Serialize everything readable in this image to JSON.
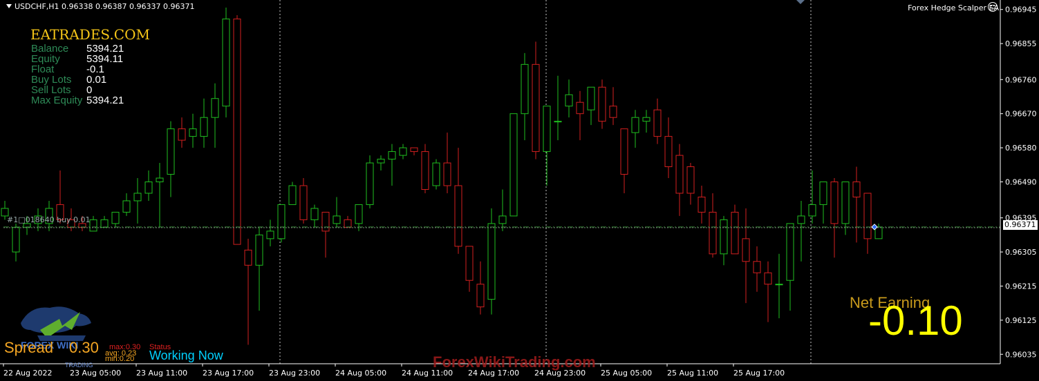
{
  "header": {
    "symbol": "USDCHF,H1  0.96338 0.96387 0.96337 0.96371",
    "ea_name": "Forex Hedge Scalper EA"
  },
  "info_panel": {
    "brand": "EATRADES.COM",
    "rows": [
      {
        "label": "Balance",
        "value": "5394.21"
      },
      {
        "label": "Equity",
        "value": "5394.11"
      },
      {
        "label": "Float",
        "value": "-0.1"
      },
      {
        "label": "Buy Lots",
        "value": "0.01"
      },
      {
        "label": "Sell Lots",
        "value": "0"
      },
      {
        "label": "Max Equity",
        "value": "5394.21"
      }
    ]
  },
  "spread": {
    "label": "Spread",
    "value": "0.30",
    "max": "max:0.30",
    "avg": "avg: 0.23",
    "min": "min:0.20",
    "status_label": "Status",
    "status_value": "Working Now"
  },
  "net_earning": {
    "label": "Net Earning",
    "value": "-0.10"
  },
  "watermark": "ForexWikiTrading.com",
  "order_line": {
    "label": "#1□018640 buy 0.01",
    "price": 0.96371
  },
  "current_price": "0.96371",
  "logo": {
    "text": "FOREX WIKI",
    "subtext": "TRADING"
  },
  "price_axis": {
    "labels": [
      "0.96945",
      "0.96855",
      "0.96760",
      "0.96670",
      "0.96580",
      "0.96490",
      "0.96395",
      "0.96305",
      "0.96215",
      "0.96125",
      "0.96035"
    ],
    "min": 0.9601,
    "max": 0.9697
  },
  "time_axis": {
    "labels": [
      "22 Aug 2022",
      "23 Aug 05:00",
      "23 Aug 11:00",
      "23 Aug 17:00",
      "23 Aug 23:00",
      "24 Aug 05:00",
      "24 Aug 11:00",
      "24 Aug 17:00",
      "24 Aug 23:00",
      "25 Aug 05:00",
      "25 Aug 11:00",
      "25 Aug 17:00"
    ]
  },
  "colors": {
    "bull": "#1fbf1f",
    "bear": "#d41f1f",
    "grid": "#c8c8c8",
    "order_line": "#3a8f3a",
    "panel_label": "#2e8b57",
    "brand": "#f5c518"
  },
  "chart_data": {
    "type": "candlestick",
    "symbol": "USDCHF",
    "timeframe": "H1",
    "candles": [
      {
        "o": 0.964,
        "h": 0.9644,
        "l": 0.9639,
        "c": 0.9642
      },
      {
        "o": 0.96305,
        "h": 0.9638,
        "l": 0.9628,
        "c": 0.9637
      },
      {
        "o": 0.9637,
        "h": 0.964,
        "l": 0.9635,
        "c": 0.9638
      },
      {
        "o": 0.9638,
        "h": 0.9642,
        "l": 0.9636,
        "c": 0.964
      },
      {
        "o": 0.9638,
        "h": 0.9644,
        "l": 0.9636,
        "c": 0.9642
      },
      {
        "o": 0.9643,
        "h": 0.9652,
        "l": 0.9638,
        "c": 0.9639
      },
      {
        "o": 0.9639,
        "h": 0.9642,
        "l": 0.9636,
        "c": 0.9637
      },
      {
        "o": 0.9638,
        "h": 0.964,
        "l": 0.9636,
        "c": 0.9637
      },
      {
        "o": 0.9636,
        "h": 0.964,
        "l": 0.9636,
        "c": 0.9639
      },
      {
        "o": 0.9637,
        "h": 0.964,
        "l": 0.9637,
        "c": 0.9639
      },
      {
        "o": 0.9638,
        "h": 0.9641,
        "l": 0.9637,
        "c": 0.9641
      },
      {
        "o": 0.9641,
        "h": 0.9646,
        "l": 0.964,
        "c": 0.9644
      },
      {
        "o": 0.9644,
        "h": 0.965,
        "l": 0.9638,
        "c": 0.9646
      },
      {
        "o": 0.9646,
        "h": 0.9652,
        "l": 0.9644,
        "c": 0.9649
      },
      {
        "o": 0.9649,
        "h": 0.9654,
        "l": 0.9637,
        "c": 0.965
      },
      {
        "o": 0.9651,
        "h": 0.9665,
        "l": 0.9645,
        "c": 0.9663
      },
      {
        "o": 0.9663,
        "h": 0.9666,
        "l": 0.9658,
        "c": 0.966
      },
      {
        "o": 0.9661,
        "h": 0.9667,
        "l": 0.9658,
        "c": 0.9663
      },
      {
        "o": 0.9661,
        "h": 0.9671,
        "l": 0.9658,
        "c": 0.9666
      },
      {
        "o": 0.9666,
        "h": 0.9675,
        "l": 0.9658,
        "c": 0.9671
      },
      {
        "o": 0.9669,
        "h": 0.9695,
        "l": 0.9666,
        "c": 0.9692
      },
      {
        "o": 0.9692,
        "h": 0.9693,
        "l": 0.96325,
        "c": 0.96325
      },
      {
        "o": 0.9631,
        "h": 0.9634,
        "l": 0.9606,
        "c": 0.9627
      },
      {
        "o": 0.9627,
        "h": 0.9637,
        "l": 0.9615,
        "c": 0.9635
      },
      {
        "o": 0.9634,
        "h": 0.9639,
        "l": 0.9632,
        "c": 0.9636
      },
      {
        "o": 0.9634,
        "h": 0.9642,
        "l": 0.9633,
        "c": 0.9643
      },
      {
        "o": 0.9643,
        "h": 0.9649,
        "l": 0.9643,
        "c": 0.9648
      },
      {
        "o": 0.9648,
        "h": 0.965,
        "l": 0.9638,
        "c": 0.9639
      },
      {
        "o": 0.9639,
        "h": 0.9643,
        "l": 0.9637,
        "c": 0.9642
      },
      {
        "o": 0.9641,
        "h": 0.9641,
        "l": 0.9629,
        "c": 0.9636
      },
      {
        "o": 0.9638,
        "h": 0.9645,
        "l": 0.9637,
        "c": 0.964
      },
      {
        "o": 0.9639,
        "h": 0.964,
        "l": 0.9637,
        "c": 0.9637
      },
      {
        "o": 0.9638,
        "h": 0.9643,
        "l": 0.9636,
        "c": 0.9643
      },
      {
        "o": 0.9643,
        "h": 0.9656,
        "l": 0.9642,
        "c": 0.9654
      },
      {
        "o": 0.9654,
        "h": 0.9656,
        "l": 0.9652,
        "c": 0.9655
      },
      {
        "o": 0.9655,
        "h": 0.9659,
        "l": 0.9648,
        "c": 0.9657
      },
      {
        "o": 0.9656,
        "h": 0.9659,
        "l": 0.9655,
        "c": 0.9658
      },
      {
        "o": 0.9658,
        "h": 0.9658,
        "l": 0.9656,
        "c": 0.9657
      },
      {
        "o": 0.9657,
        "h": 0.9659,
        "l": 0.9646,
        "c": 0.9647
      },
      {
        "o": 0.9648,
        "h": 0.9655,
        "l": 0.9647,
        "c": 0.9654
      },
      {
        "o": 0.9654,
        "h": 0.9662,
        "l": 0.9646,
        "c": 0.9648
      },
      {
        "o": 0.9648,
        "h": 0.9658,
        "l": 0.963,
        "c": 0.9632
      },
      {
        "o": 0.9632,
        "h": 0.9632,
        "l": 0.962,
        "c": 0.9623
      },
      {
        "o": 0.9622,
        "h": 0.9628,
        "l": 0.9614,
        "c": 0.9616
      },
      {
        "o": 0.9618,
        "h": 0.9642,
        "l": 0.9614,
        "c": 0.9638
      },
      {
        "o": 0.9638,
        "h": 0.9647,
        "l": 0.9636,
        "c": 0.964
      },
      {
        "o": 0.964,
        "h": 0.9667,
        "l": 0.964,
        "c": 0.9667
      },
      {
        "o": 0.9667,
        "h": 0.9683,
        "l": 0.966,
        "c": 0.968
      },
      {
        "o": 0.968,
        "h": 0.9686,
        "l": 0.9655,
        "c": 0.9657
      },
      {
        "o": 0.9657,
        "h": 0.9669,
        "l": 0.9648,
        "c": 0.9669
      },
      {
        "o": 0.9665,
        "h": 0.9677,
        "l": 0.966,
        "c": 0.9665
      },
      {
        "o": 0.9669,
        "h": 0.9676,
        "l": 0.9666,
        "c": 0.9672
      },
      {
        "o": 0.967,
        "h": 0.9673,
        "l": 0.966,
        "c": 0.9667
      },
      {
        "o": 0.9668,
        "h": 0.9674,
        "l": 0.9664,
        "c": 0.9674
      },
      {
        "o": 0.9674,
        "h": 0.9676,
        "l": 0.9663,
        "c": 0.9665
      },
      {
        "o": 0.9669,
        "h": 0.9674,
        "l": 0.9664,
        "c": 0.9666
      },
      {
        "o": 0.9663,
        "h": 0.9662,
        "l": 0.9646,
        "c": 0.9651
      },
      {
        "o": 0.9662,
        "h": 0.9668,
        "l": 0.9658,
        "c": 0.9666
      },
      {
        "o": 0.9665,
        "h": 0.9668,
        "l": 0.9662,
        "c": 0.9666
      },
      {
        "o": 0.9668,
        "h": 0.9671,
        "l": 0.9659,
        "c": 0.9661
      },
      {
        "o": 0.9661,
        "h": 0.9666,
        "l": 0.965,
        "c": 0.9653
      },
      {
        "o": 0.9656,
        "h": 0.9659,
        "l": 0.964,
        "c": 0.9646
      },
      {
        "o": 0.9653,
        "h": 0.9654,
        "l": 0.9643,
        "c": 0.9646
      },
      {
        "o": 0.9645,
        "h": 0.9648,
        "l": 0.9638,
        "c": 0.9641
      },
      {
        "o": 0.9641,
        "h": 0.9646,
        "l": 0.9629,
        "c": 0.963
      },
      {
        "o": 0.963,
        "h": 0.964,
        "l": 0.9627,
        "c": 0.9639
      },
      {
        "o": 0.9641,
        "h": 0.9643,
        "l": 0.963,
        "c": 0.963
      },
      {
        "o": 0.9634,
        "h": 0.9642,
        "l": 0.9617,
        "c": 0.9628
      },
      {
        "o": 0.9628,
        "h": 0.9632,
        "l": 0.962,
        "c": 0.9625
      },
      {
        "o": 0.9625,
        "h": 0.9628,
        "l": 0.9612,
        "c": 0.9622
      },
      {
        "o": 0.9622,
        "h": 0.963,
        "l": 0.9613,
        "c": 0.9622
      },
      {
        "o": 0.9623,
        "h": 0.9632,
        "l": 0.9615,
        "c": 0.9638
      },
      {
        "o": 0.9638,
        "h": 0.9644,
        "l": 0.9628,
        "c": 0.964
      },
      {
        "o": 0.964,
        "h": 0.9652,
        "l": 0.9638,
        "c": 0.9643
      },
      {
        "o": 0.9643,
        "h": 0.9648,
        "l": 0.9638,
        "c": 0.9649
      },
      {
        "o": 0.9649,
        "h": 0.965,
        "l": 0.9629,
        "c": 0.9638
      },
      {
        "o": 0.9638,
        "h": 0.9648,
        "l": 0.9635,
        "c": 0.9649
      },
      {
        "o": 0.9649,
        "h": 0.9653,
        "l": 0.9633,
        "c": 0.9645
      },
      {
        "o": 0.9646,
        "h": 0.9646,
        "l": 0.963,
        "c": 0.9634
      },
      {
        "o": 0.9634,
        "h": 0.9638,
        "l": 0.9634,
        "c": 0.96371
      }
    ]
  }
}
